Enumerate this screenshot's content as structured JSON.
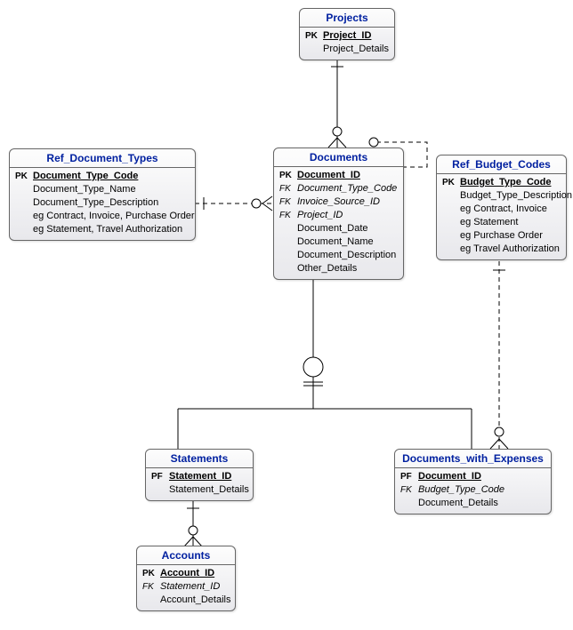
{
  "entities": {
    "projects": {
      "title": "Projects",
      "rows": [
        {
          "key": "PK",
          "name": "Project_ID",
          "pk": true
        },
        {
          "key": "",
          "name": "Project_Details"
        }
      ]
    },
    "ref_doc_types": {
      "title": "Ref_Document_Types",
      "rows": [
        {
          "key": "PK",
          "name": "Document_Type_Code",
          "pk": true
        },
        {
          "key": "",
          "name": "Document_Type_Name"
        },
        {
          "key": "",
          "name": "Document_Type_Description"
        },
        {
          "key": "",
          "name": "eg Contract, Invoice, Purchase Order"
        },
        {
          "key": "",
          "name": "eg Statement, Travel Authorization"
        }
      ]
    },
    "documents": {
      "title": "Documents",
      "rows": [
        {
          "key": "PK",
          "name": "Document_ID",
          "pk": true
        },
        {
          "key": "FK",
          "name": "Document_Type_Code",
          "fk": true
        },
        {
          "key": "FK",
          "name": "Invoice_Source_ID",
          "fk": true
        },
        {
          "key": "FK",
          "name": "Project_ID",
          "fk": true
        },
        {
          "key": "",
          "name": "Document_Date"
        },
        {
          "key": "",
          "name": "Document_Name"
        },
        {
          "key": "",
          "name": "Document_Description"
        },
        {
          "key": "",
          "name": "Other_Details"
        }
      ]
    },
    "ref_budget_codes": {
      "title": "Ref_Budget_Codes",
      "rows": [
        {
          "key": "PK",
          "name": "Budget_Type_Code",
          "pk": true
        },
        {
          "key": "",
          "name": "Budget_Type_Description"
        },
        {
          "key": "",
          "name": "eg Contract, Invoice"
        },
        {
          "key": "",
          "name": "eg Statement"
        },
        {
          "key": "",
          "name": "eg Purchase Order"
        },
        {
          "key": "",
          "name": "eg Travel Authorization"
        }
      ]
    },
    "statements": {
      "title": "Statements",
      "rows": [
        {
          "key": "PF",
          "name": "Statement_ID",
          "pk": true
        },
        {
          "key": "",
          "name": "Statement_Details"
        }
      ]
    },
    "docs_expenses": {
      "title": "Documents_with_Expenses",
      "rows": [
        {
          "key": "PF",
          "name": "Document_ID",
          "pk": true
        },
        {
          "key": "FK",
          "name": "Budget_Type_Code",
          "fk": true
        },
        {
          "key": "",
          "name": "Document_Details"
        }
      ]
    },
    "accounts": {
      "title": "Accounts",
      "rows": [
        {
          "key": "PK",
          "name": "Account_ID",
          "pk": true
        },
        {
          "key": "FK",
          "name": "Statement_ID",
          "fk": true
        },
        {
          "key": "",
          "name": "Account_Details"
        }
      ]
    }
  }
}
